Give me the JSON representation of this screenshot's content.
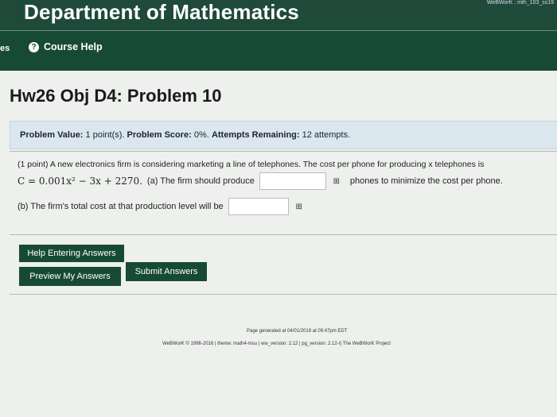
{
  "header": {
    "department": "Department of Mathematics",
    "top_right": "WeBWorK : mth_103_ss19"
  },
  "nav": {
    "left_fragment": "es",
    "course_help": "Course Help",
    "help_glyph": "?"
  },
  "page_title": "Hw26 Obj D4: Problem 10",
  "info": {
    "value_label": "Problem Value:",
    "value": "1 point(s).",
    "score_label": "Problem Score:",
    "score": "0%.",
    "attempts_label": "Attempts Remaining:",
    "attempts": "12 attempts."
  },
  "problem": {
    "line1": "(1 point) A new electronics firm is considering marketing a line of telephones. The cost per phone for producing x telephones is",
    "equation": "C = 0.001x² − 3x + 2270.",
    "part_a": "(a) The firm should produce",
    "part_a_suffix": "phones to minimize the cost per phone.",
    "part_b": "(b) The firm's total cost at that production level will be",
    "answer_a": "",
    "answer_b": ""
  },
  "buttons": {
    "help_entering": "Help Entering Answers",
    "preview": "Preview My Answers",
    "submit": "Submit Answers"
  },
  "footer": {
    "generated": "Page generated at 04/01/2019 at 09:47pm EDT",
    "credits": "WeBWorK © 1996-2016 | theme: math4-msu | ww_version: 2.12 | pg_version: 2.12-r| The WeBWorK Project"
  },
  "colors": {
    "brand_green": "#174a36",
    "info_bg": "#dbe7ee"
  }
}
